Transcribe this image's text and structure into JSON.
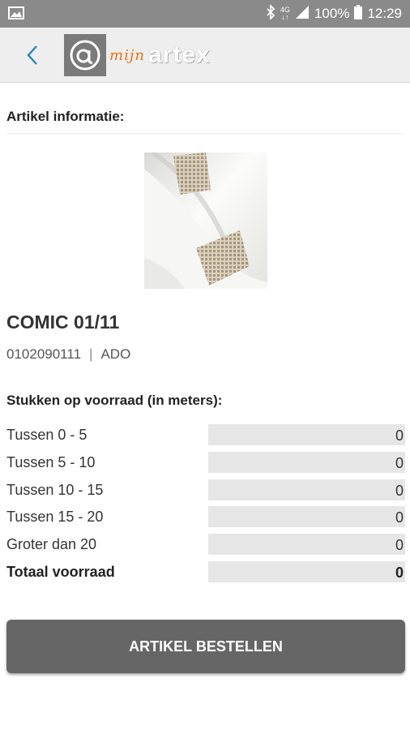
{
  "status_bar": {
    "network_top": "4G",
    "network_bottom": "↓↑",
    "battery": "100%",
    "time": "12:29",
    "icons": [
      "image-icon",
      "bluetooth-icon",
      "signal-icon",
      "battery-icon"
    ]
  },
  "app_bar": {
    "logo_letter": "@",
    "logo_mijn": "mijn",
    "logo_brand": "artex",
    "accent_color": "#e8720c",
    "back_icon_color": "#1e88c7"
  },
  "main": {
    "section_title": "Artikel informatie:",
    "product_name": "COMIC 01/11",
    "article_number": "0102090111",
    "separator": "|",
    "supplier_code": "ADO",
    "stock_title": "Stukken op voorraad (in meters):",
    "stock_rows": [
      {
        "label": "Tussen 0 - 5",
        "value": "0"
      },
      {
        "label": "Tussen 5 - 10",
        "value": "0"
      },
      {
        "label": "Tussen 10 - 15",
        "value": "0"
      },
      {
        "label": "Tussen 15 - 20",
        "value": "0"
      },
      {
        "label": "Groter dan 20",
        "value": "0"
      },
      {
        "label": "Totaal voorraad",
        "value": "0"
      }
    ],
    "order_button": "ARTIKEL BESTELLEN"
  }
}
